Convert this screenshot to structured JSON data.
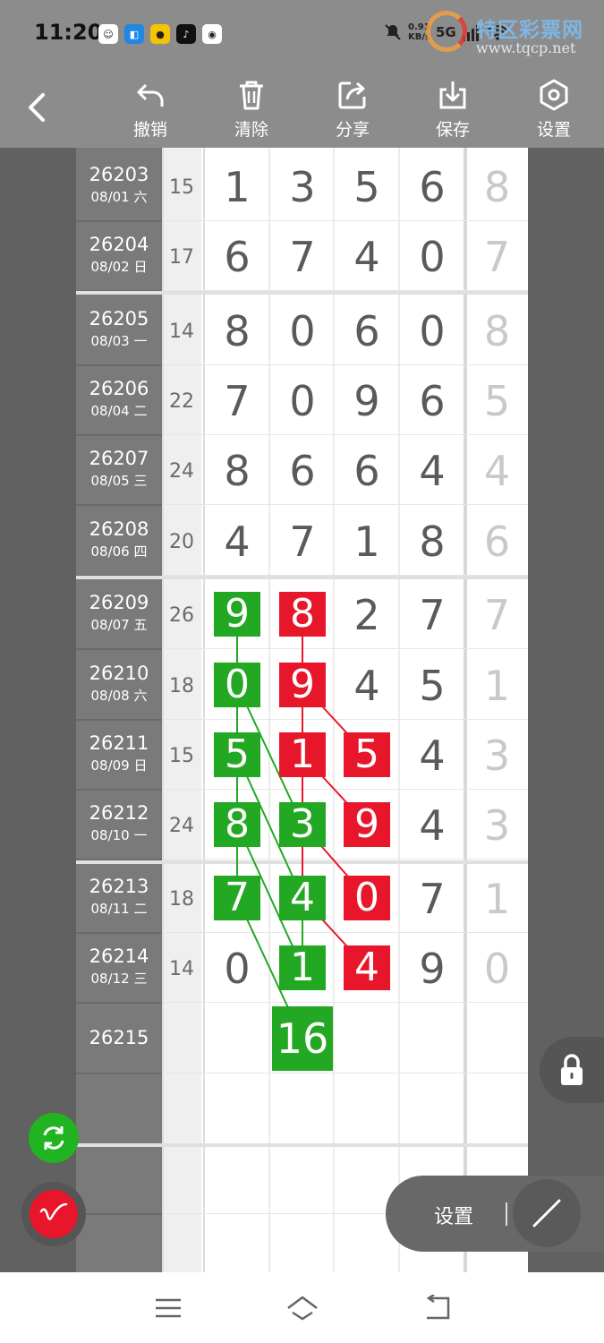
{
  "status": {
    "time": "11:20",
    "net_speed": "0.91",
    "net_unit": "KB/s",
    "net_type": "5G"
  },
  "watermark": {
    "name": "特区彩票网",
    "url": "www.tqcp.net"
  },
  "toolbar": {
    "undo": "撤销",
    "clear": "清除",
    "share": "分享",
    "save": "保存",
    "settings": "设置"
  },
  "rows": [
    {
      "issue": "26203",
      "date": "08/01 六",
      "sum": "15",
      "digits": [
        "1",
        "3",
        "5",
        "6"
      ],
      "tail": "8"
    },
    {
      "issue": "26204",
      "date": "08/02 日",
      "sum": "17",
      "digits": [
        "6",
        "7",
        "4",
        "0"
      ],
      "tail": "7"
    },
    {
      "issue": "26205",
      "date": "08/03 一",
      "sum": "14",
      "digits": [
        "8",
        "0",
        "6",
        "0"
      ],
      "tail": "8"
    },
    {
      "issue": "26206",
      "date": "08/04 二",
      "sum": "22",
      "digits": [
        "7",
        "0",
        "9",
        "6"
      ],
      "tail": "5"
    },
    {
      "issue": "26207",
      "date": "08/05 三",
      "sum": "24",
      "digits": [
        "8",
        "6",
        "6",
        "4"
      ],
      "tail": "4"
    },
    {
      "issue": "26208",
      "date": "08/06 四",
      "sum": "20",
      "digits": [
        "4",
        "7",
        "1",
        "8"
      ],
      "tail": "6"
    },
    {
      "issue": "26209",
      "date": "08/07 五",
      "sum": "26",
      "digits": [
        "9",
        "8",
        "2",
        "7"
      ],
      "tail": "7"
    },
    {
      "issue": "26210",
      "date": "08/08 六",
      "sum": "18",
      "digits": [
        "0",
        "9",
        "4",
        "5"
      ],
      "tail": "1"
    },
    {
      "issue": "26211",
      "date": "08/09 日",
      "sum": "15",
      "digits": [
        "5",
        "1",
        "5",
        "4"
      ],
      "tail": "3"
    },
    {
      "issue": "26212",
      "date": "08/10 一",
      "sum": "24",
      "digits": [
        "8",
        "3",
        "9",
        "4"
      ],
      "tail": "3"
    },
    {
      "issue": "26213",
      "date": "08/11 二",
      "sum": "18",
      "digits": [
        "7",
        "4",
        "0",
        "7"
      ],
      "tail": "1"
    },
    {
      "issue": "26214",
      "date": "08/12 三",
      "sum": "14",
      "digits": [
        "0",
        "1",
        "4",
        "9"
      ],
      "tail": "0"
    },
    {
      "issue": "26215",
      "date": "",
      "sum": "",
      "digits": [
        "",
        "",
        "",
        ""
      ],
      "tail": ""
    }
  ],
  "highlights": {
    "green": [
      {
        "row": 6,
        "col": 0,
        "value": "9"
      },
      {
        "row": 7,
        "col": 0,
        "value": "0"
      },
      {
        "row": 8,
        "col": 0,
        "value": "5"
      },
      {
        "row": 9,
        "col": 0,
        "value": "8"
      },
      {
        "row": 10,
        "col": 0,
        "value": "7"
      },
      {
        "row": 9,
        "col": 1,
        "value": "3"
      },
      {
        "row": 10,
        "col": 1,
        "value": "4"
      },
      {
        "row": 11,
        "col": 1,
        "value": "1"
      }
    ],
    "red": [
      {
        "row": 6,
        "col": 1,
        "value": "8"
      },
      {
        "row": 7,
        "col": 1,
        "value": "9"
      },
      {
        "row": 8,
        "col": 1,
        "value": "1"
      },
      {
        "row": 8,
        "col": 2,
        "value": "5"
      },
      {
        "row": 9,
        "col": 2,
        "value": "9"
      },
      {
        "row": 10,
        "col": 2,
        "value": "0"
      },
      {
        "row": 11,
        "col": 2,
        "value": "4"
      }
    ],
    "prediction": {
      "row": 12,
      "col": 1,
      "value": "16"
    }
  },
  "colors": {
    "green": "#22a822",
    "red": "#e8162b"
  },
  "bottom_panel": {
    "settings_label": "设置"
  },
  "icons": {
    "back": "chevron-left-icon",
    "undo": "undo-icon",
    "clear": "trash-icon",
    "share": "share-icon",
    "save": "download-icon",
    "settings": "hexagon-gear-icon",
    "sync": "sync-icon",
    "pen": "pen-icon",
    "lock": "lock-icon",
    "line": "line-tool-icon"
  }
}
